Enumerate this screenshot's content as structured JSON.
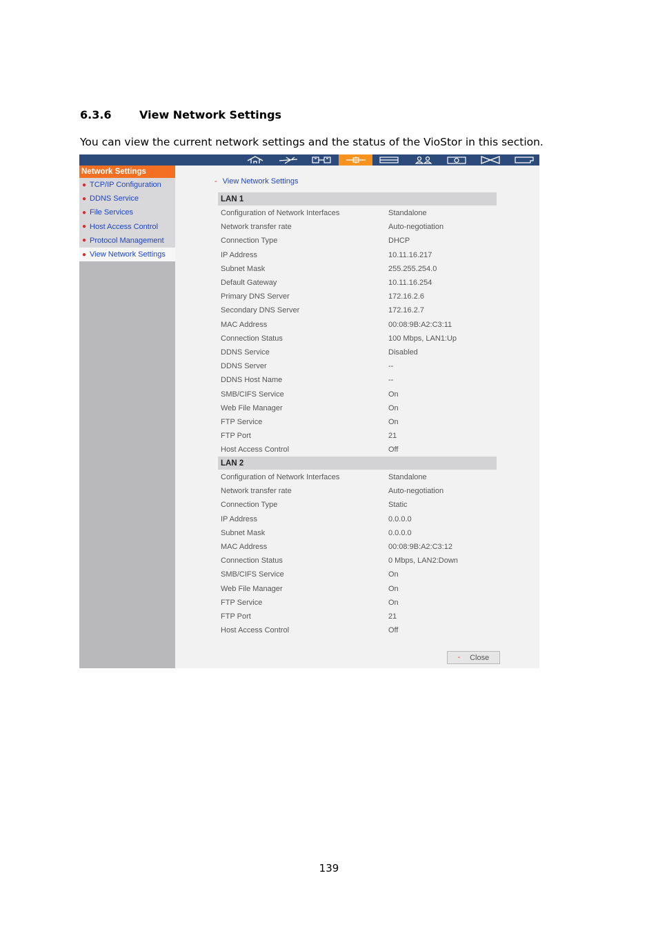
{
  "section": {
    "number": "6.3.6",
    "title": "View Network Settings"
  },
  "intro": "You can view the current network settings and the status of the VioStor in this section.",
  "toolbar": {
    "icons": [
      "home-icon",
      "plane-icon",
      "storage-icon",
      "network-icon",
      "list-icon",
      "users-icon",
      "camera-icon",
      "bowtie-icon",
      "folder-icon"
    ],
    "active_index": 3,
    "colors": {
      "bar": "#2c4a7a",
      "active": "#f7931e"
    }
  },
  "sidebar": {
    "title": "Network Settings",
    "items": [
      {
        "label": "TCP/IP Configuration"
      },
      {
        "label": "DDNS Service"
      },
      {
        "label": "File Services"
      },
      {
        "label": "Host Access Control"
      },
      {
        "label": "Protocol Management"
      },
      {
        "label": "View Network Settings"
      }
    ]
  },
  "breadcrumb": "View Network Settings",
  "lan1": {
    "title": "LAN 1",
    "rows": [
      {
        "label": "Configuration of Network Interfaces",
        "value": "Standalone"
      },
      {
        "label": "Network transfer rate",
        "value": "Auto-negotiation"
      },
      {
        "label": "Connection Type",
        "value": "DHCP"
      },
      {
        "label": "IP Address",
        "value": "10.11.16.217"
      },
      {
        "label": "Subnet Mask",
        "value": "255.255.254.0"
      },
      {
        "label": "Default Gateway",
        "value": "10.11.16.254"
      },
      {
        "label": "Primary DNS Server",
        "value": "172.16.2.6"
      },
      {
        "label": "Secondary DNS Server",
        "value": "172.16.2.7"
      },
      {
        "label": "MAC Address",
        "value": "00:08:9B:A2:C3:11"
      },
      {
        "label": "Connection Status",
        "value": "100 Mbps, LAN1:Up"
      },
      {
        "label": "DDNS Service",
        "value": "Disabled"
      },
      {
        "label": "DDNS Server",
        "value": "--"
      },
      {
        "label": "DDNS Host Name",
        "value": "--"
      },
      {
        "label": "SMB/CIFS Service",
        "value": "On"
      },
      {
        "label": "Web File Manager",
        "value": "On"
      },
      {
        "label": "FTP Service",
        "value": "On"
      },
      {
        "label": "FTP Port",
        "value": "21"
      },
      {
        "label": "Host Access Control",
        "value": "Off"
      }
    ]
  },
  "lan2": {
    "title": "LAN 2",
    "rows": [
      {
        "label": "Configuration of Network Interfaces",
        "value": "Standalone"
      },
      {
        "label": "Network transfer rate",
        "value": "Auto-negotiation"
      },
      {
        "label": "Connection Type",
        "value": "Static"
      },
      {
        "label": "IP Address",
        "value": "0.0.0.0"
      },
      {
        "label": "Subnet Mask",
        "value": "0.0.0.0"
      },
      {
        "label": "MAC Address",
        "value": "00:08:9B:A2:C3:12"
      },
      {
        "label": "Connection Status",
        "value": "0 Mbps, LAN2:Down"
      },
      {
        "label": "SMB/CIFS Service",
        "value": "On"
      },
      {
        "label": "Web File Manager",
        "value": "On"
      },
      {
        "label": "FTP Service",
        "value": "On"
      },
      {
        "label": "FTP Port",
        "value": "21"
      },
      {
        "label": "Host Access Control",
        "value": "Off"
      }
    ]
  },
  "close_label": "Close",
  "page_number": "139"
}
